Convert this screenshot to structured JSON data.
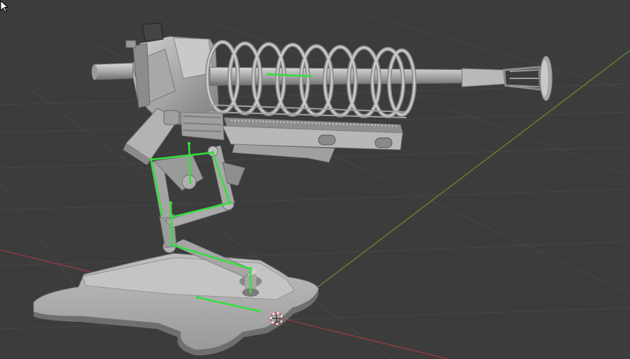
{
  "app": {
    "editor": "3d-viewport",
    "object": "turret-mesh",
    "armature": "turret-armature"
  },
  "colors": {
    "background": "#3c3c3c",
    "grid_line": "#474747",
    "x_axis": "#9c3a44",
    "y_axis": "#6a8a2e",
    "bone": "#34e03c",
    "mesh_light": "#bdbdbd",
    "mesh_mid": "#9a9a9a",
    "mesh_dark": "#6c6c6c",
    "cursor_3d_red": "#e0404a"
  },
  "icons": [
    "mouse-pointer-icon",
    "3d-cursor-icon"
  ]
}
